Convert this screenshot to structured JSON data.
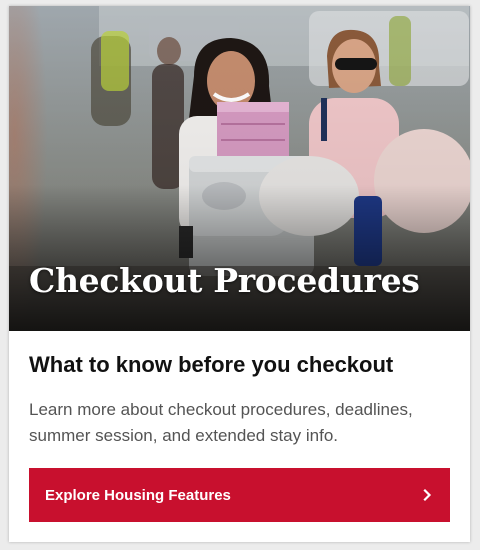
{
  "card": {
    "hero": {
      "title": "Checkout Procedures",
      "image_description_icon": "students-moving-out-photo"
    },
    "subhead": "What to know before you checkout",
    "description": "Learn more about checkout procedures, deadlines, summer session, and extended stay info.",
    "cta": {
      "label": "Explore Housing Features",
      "icon": "chevron-right-icon"
    }
  },
  "colors": {
    "accent": "#c8102e",
    "text_dark": "#111111",
    "text_body": "#545454",
    "background": "#ececec"
  }
}
